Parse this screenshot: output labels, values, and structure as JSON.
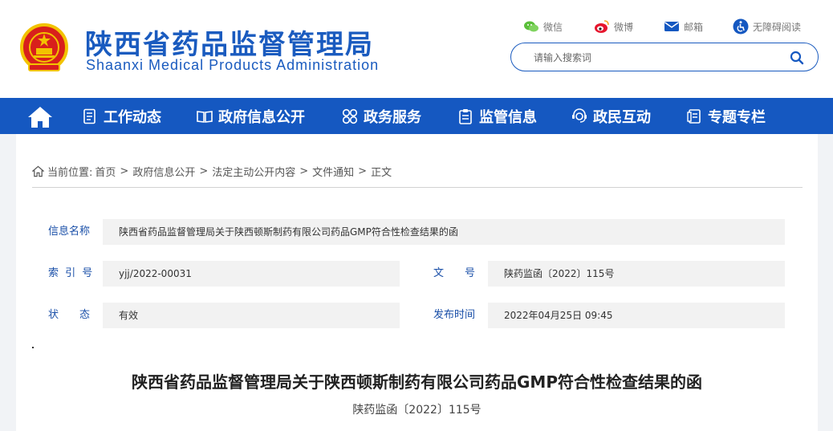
{
  "header": {
    "title": "陕西省药品监督管理局",
    "subtitle": "Shaanxi Medical Products Administration",
    "links": [
      {
        "label": "微信",
        "icon": "wechat-icon"
      },
      {
        "label": "微博",
        "icon": "weibo-icon"
      },
      {
        "label": "邮箱",
        "icon": "mail-icon"
      },
      {
        "label": "无障碍阅读",
        "icon": "accessibility-icon"
      }
    ],
    "search": {
      "placeholder": "请输入搜索词"
    }
  },
  "nav": {
    "items": [
      {
        "label": "工作动态",
        "icon": "document-list-icon"
      },
      {
        "label": "政府信息公开",
        "icon": "open-book-icon"
      },
      {
        "label": "政务服务",
        "icon": "grid-circles-icon"
      },
      {
        "label": "监管信息",
        "icon": "clipboard-icon"
      },
      {
        "label": "政民互动",
        "icon": "interaction-icon"
      },
      {
        "label": "专题专栏",
        "icon": "folder-document-icon"
      }
    ]
  },
  "breadcrumb": {
    "prefix": "当前位置:",
    "items": [
      "首页",
      "政府信息公开",
      "法定主动公开内容",
      "文件通知",
      "正文"
    ],
    "separator": ">"
  },
  "meta": {
    "name_label": "信息名称",
    "name_value": "陕西省药品监督管理局关于陕西顿斯制药有限公司药品GMP符合性检查结果的函",
    "index_label": "索 引 号",
    "index_value": "yjj/2022-00031",
    "docno_label": "文　　号",
    "docno_value": "陕药监函〔2022〕115号",
    "status_label": "状　　态",
    "status_value": "有效",
    "date_label": "发布时间",
    "date_value": "2022年04月25日 09:45"
  },
  "article": {
    "title": "陕西省药品监督管理局关于陕西顿斯制药有限公司药品GMP符合性检查结果的函",
    "number": "陕药监函〔2022〕115号"
  },
  "colors": {
    "brand_blue": "#1558c1",
    "label_blue": "#1a4fa8",
    "emblem_red": "#d8201c",
    "emblem_gold": "#f2c300"
  }
}
